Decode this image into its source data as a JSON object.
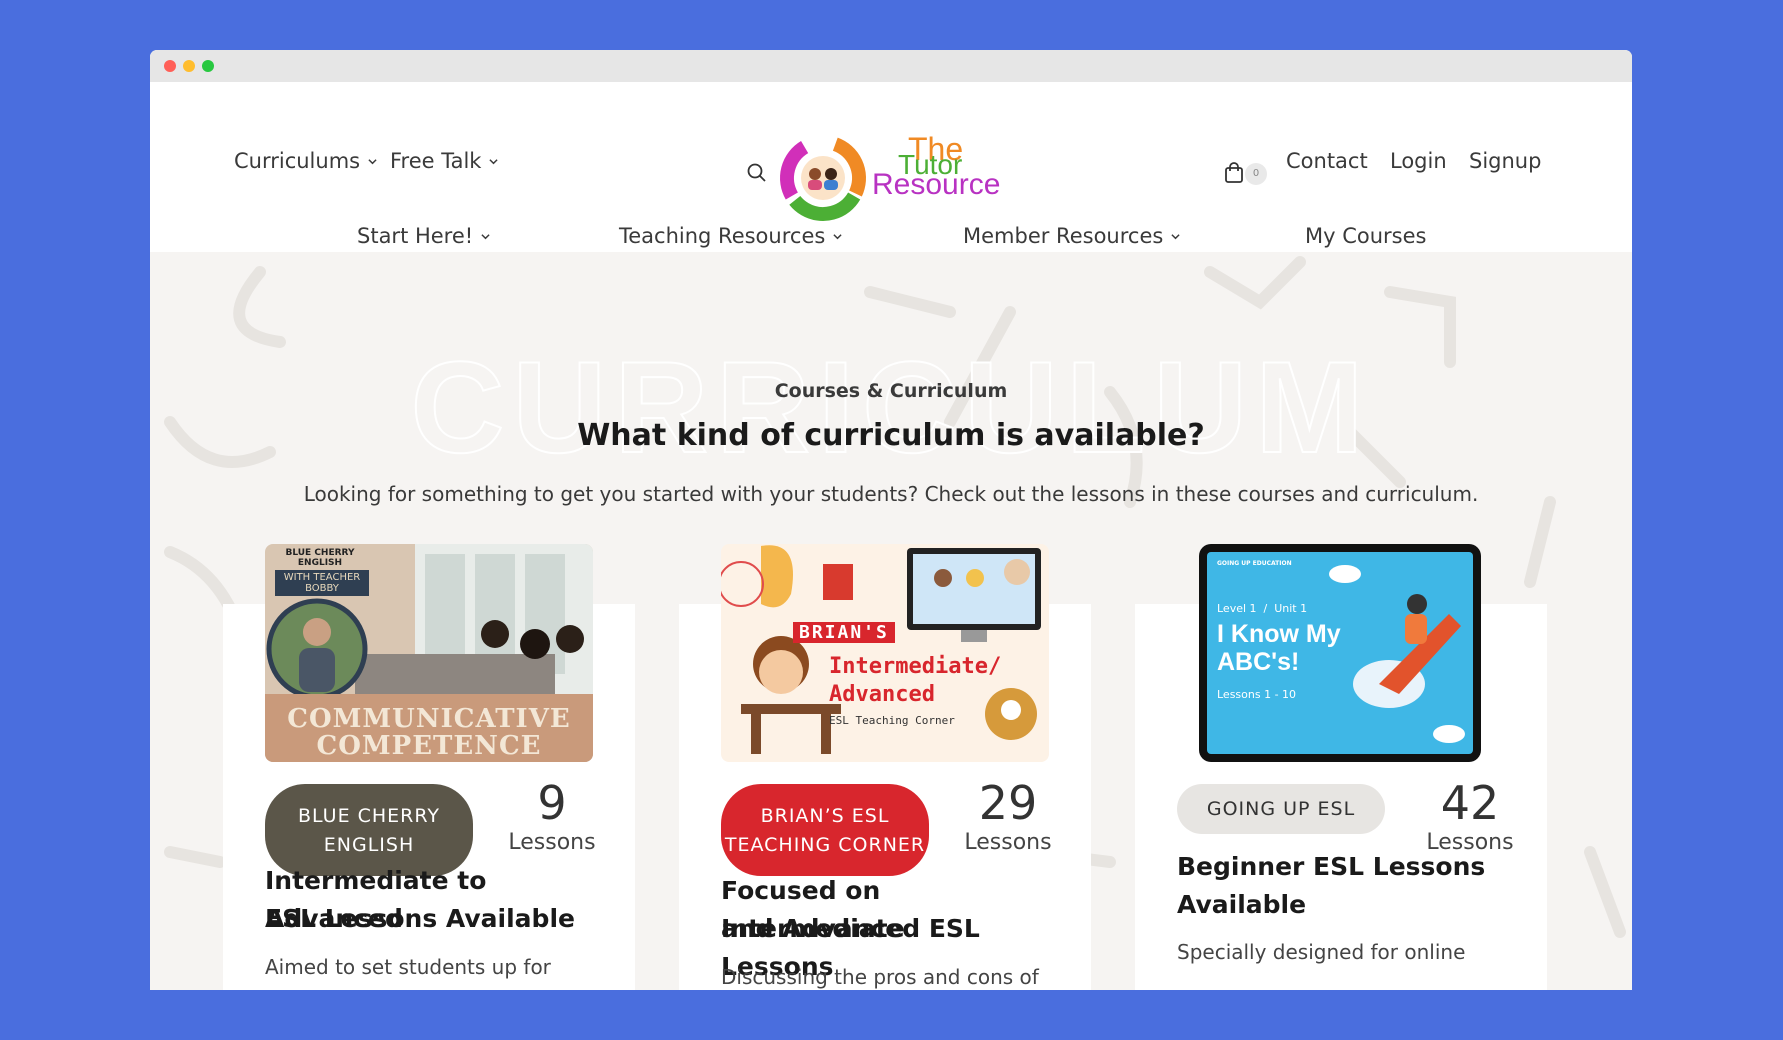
{
  "nav": {
    "top_left": [
      "Curriculums",
      "Free Talk"
    ],
    "top_right": [
      "Contact",
      "Login",
      "Signup"
    ],
    "cart_count": "0",
    "secondary": [
      "Start Here!",
      "Teaching Resources",
      "Member Resources",
      "My Courses"
    ]
  },
  "logo": {
    "line1": "The",
    "line2": "Tutor",
    "line3": "Resource"
  },
  "hero": {
    "watermark": "CURRICULUM",
    "eyebrow": "Courses & Curriculum",
    "headline": "What kind of curriculum is available?",
    "intro": "Looking for something to get you started with your students? Check out the lessons in these courses and curriculum."
  },
  "cards": [
    {
      "image": {
        "brand": "BLUE CHERRY ENGLISH",
        "ribbon": "WITH TEACHER BOBBY",
        "banner_line1": "COMMUNICATIVE",
        "banner_line2": "COMPETENCE"
      },
      "pill_line1": "BLUE CHERRY",
      "pill_line2": "ENGLISH",
      "count": "9",
      "unit": "Lessons",
      "title_line1": "Intermediate to Advanced",
      "title_line2": "ESL Lessons Available",
      "desc": "Aimed to set students up for"
    },
    {
      "image": {
        "brand": "BRIAN'S",
        "line1": "Intermediate/",
        "line2": "Advanced",
        "line3": "ESL Teaching Corner"
      },
      "pill_line1": "BRIAN’S ESL",
      "pill_line2": "TEACHING CORNER",
      "count": "29",
      "unit": "Lessons",
      "title_line1": "Focused on Intermediate",
      "title_line2": "and Advanced ESL Lessons",
      "desc": "Discussing the pros and cons of"
    },
    {
      "image": {
        "brand": "GOING UP EDUCATION",
        "level": "Level 1  /  Unit 1",
        "line1": "I Know My",
        "line2": "ABC's!",
        "line3": "Lessons 1 - 10"
      },
      "pill_line1": "GOING UP ESL",
      "count": "42",
      "unit": "Lessons",
      "title_line1": "Beginner ESL Lessons",
      "title_line2": "Available",
      "desc": "Specially designed for online"
    }
  ],
  "colors": {
    "page_bg": "#4a6ede",
    "pill_dark": "#5b5649",
    "pill_red": "#d8262d",
    "pill_light": "#e7e5e2"
  }
}
